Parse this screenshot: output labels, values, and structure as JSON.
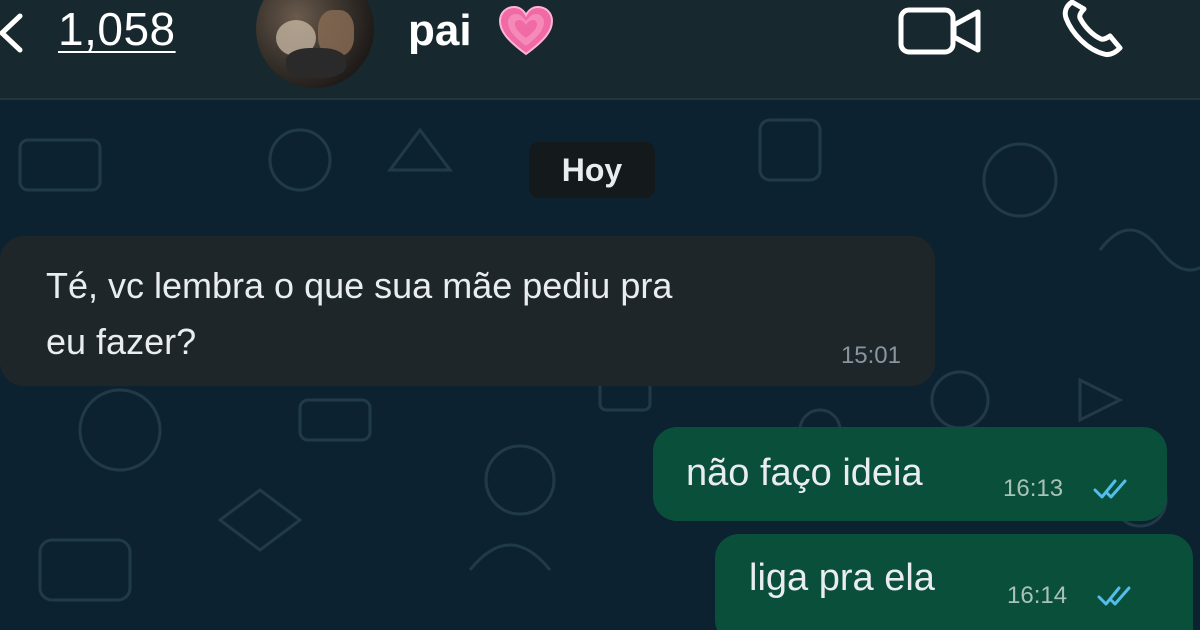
{
  "header": {
    "back_count": "1,058",
    "contact_name": "pai",
    "icons": {
      "back": "chevron-left-icon",
      "heart": "pink-heart-icon",
      "video": "video-camera-icon",
      "call": "phone-icon"
    },
    "colors": {
      "background": "#17282e",
      "heart": "#f06aa6"
    }
  },
  "chat": {
    "date_chip": "Hoy",
    "messages": [
      {
        "direction": "incoming",
        "text_line1": "Té, vc lembra o que sua mãe pediu pra",
        "text_line2": "eu fazer?",
        "time": "15:01"
      },
      {
        "direction": "outgoing",
        "text": "não faço ideia",
        "time": "16:13",
        "status": "read"
      },
      {
        "direction": "outgoing",
        "text": "liga pra ela",
        "time": "16:14",
        "status": "read"
      }
    ],
    "colors": {
      "wallpaper": "#0d2230",
      "incoming_bubble": "#1f2629",
      "outgoing_bubble": "#0a4f3a",
      "read_ticks": "#53bdeb"
    }
  }
}
